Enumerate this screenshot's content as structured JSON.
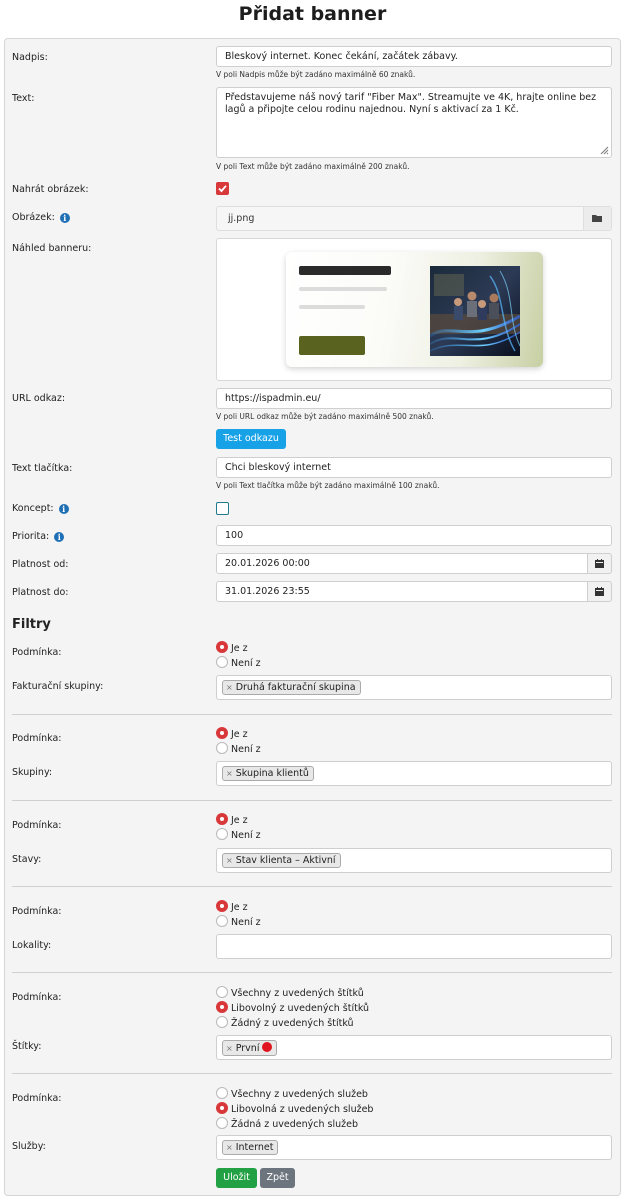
{
  "page": {
    "title": "Přidat banner"
  },
  "form": {
    "nadpis": {
      "label": "Nadpis:",
      "value": "Bleskový internet. Konec čekání, začátek zábavy.",
      "hint": "V poli Nadpis může být zadáno maximálně 60 znaků."
    },
    "text": {
      "label": "Text:",
      "value": "Představujeme náš nový tarif \"Fiber Max\". Streamujte ve 4K, hrajte online bez lagů a připojte celou rodinu najednou. Nyní s aktivací za 1 Kč.",
      "hint": "V poli Text může být zadáno maximálně 200 znaků."
    },
    "nahrat_obrazek": {
      "label": "Nahrát obrázek:",
      "checked": true
    },
    "obrazek": {
      "label": "Obrázek:",
      "value": "jj.png"
    },
    "nahled": {
      "label": "Náhled banneru:"
    },
    "url": {
      "label": "URL odkaz:",
      "value": "https://ispadmin.eu/",
      "hint": "V poli URL odkaz může být zadáno maximálně 500 znaků.",
      "test_button": "Test odkazu"
    },
    "text_tlacitka": {
      "label": "Text tlačítka:",
      "value": "Chci bleskový internet",
      "hint": "V poli Text tlačítka může být zadáno maximálně 100 znaků."
    },
    "koncept": {
      "label": "Koncept:",
      "checked": false
    },
    "priorita": {
      "label": "Priorita:",
      "value": "100"
    },
    "platnost_od": {
      "label": "Platnost od:",
      "value": "20.01.2026 00:00"
    },
    "platnost_do": {
      "label": "Platnost do:",
      "value": "31.01.2026 23:55"
    }
  },
  "filters": {
    "title": "Filtry",
    "fakturacni": {
      "condition_label": "Podmínka:",
      "options": [
        "Je z",
        "Není z"
      ],
      "selected": 0,
      "field_label": "Fakturační skupiny:",
      "tags": [
        "Druhá fakturační skupina"
      ]
    },
    "skupiny": {
      "condition_label": "Podmínka:",
      "options": [
        "Je z",
        "Není z"
      ],
      "selected": 0,
      "field_label": "Skupiny:",
      "tags": [
        "Skupina klientů"
      ]
    },
    "stavy": {
      "condition_label": "Podmínka:",
      "options": [
        "Je z",
        "Není z"
      ],
      "selected": 0,
      "field_label": "Stavy:",
      "tags": [
        "Stav klienta – Aktivní"
      ]
    },
    "lokality": {
      "condition_label": "Podmínka:",
      "options": [
        "Je z",
        "Není z"
      ],
      "selected": 0,
      "field_label": "Lokality:"
    },
    "stitky": {
      "condition_label": "Podmínka:",
      "options": [
        "Všechny z uvedených štítků",
        "Libovolný z uvedených štítků",
        "Žádný z uvedených štítků"
      ],
      "selected": 1,
      "field_label": "Štítky:",
      "tags": [
        "První"
      ],
      "tag_color": "#e0141e"
    },
    "sluzby": {
      "condition_label": "Podmínka:",
      "options": [
        "Všechny z uvedených služeb",
        "Libovolná z uvedených služeb",
        "Žádná z uvedených služeb"
      ],
      "selected": 1,
      "field_label": "Služby:",
      "tags": [
        "Internet"
      ]
    }
  },
  "actions": {
    "save": "Uložit",
    "back": "Zpět"
  },
  "colors": {
    "accent_red": "#d9383a",
    "save_green": "#22a144",
    "back_gray": "#6c757d",
    "test_blue": "#17a2e8",
    "info_blue": "#1f6fb5"
  }
}
